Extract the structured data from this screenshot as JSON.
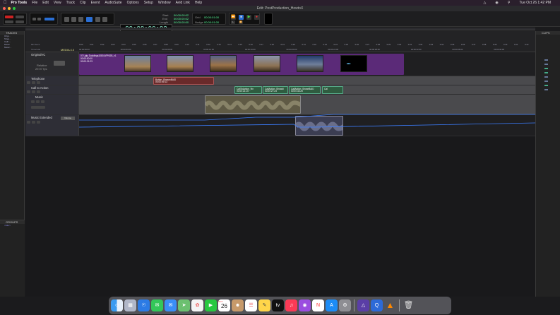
{
  "menubar": {
    "app_name": "Pro Tools",
    "items": [
      "File",
      "Edit",
      "View",
      "Track",
      "Clip",
      "Event",
      "AudioSuite",
      "Options",
      "Setup",
      "Window",
      "Avid Link",
      "Help"
    ],
    "clock": "Tue Oct 26  1:42 PM"
  },
  "window": {
    "title": "Edit: PostProduction_HowtoX"
  },
  "toolbar": {
    "main_counter": "00:00:00:02",
    "sub_labels": {
      "start": "Start",
      "end": "End",
      "length": "Length"
    },
    "start_value": "00:00:00:02",
    "end_value": "00:00:00:02",
    "length_value": "00:00:00:00",
    "cursor_label": "Cursor",
    "cursor_value": "00:00:12:24:00",
    "nudge_label": "Nudge",
    "grid_label": "Grid",
    "grid_value": "00:00:01:00",
    "nudge_value": "00:00:01:00"
  },
  "panels": {
    "tracks_title": "TRACKS",
    "clips_title": "CLIPS",
    "groups_title": "GROUPS",
    "groups_item": "<ALL>"
  },
  "track_list": [
    "Origi...",
    "Telep...",
    "Call t...",
    "Music",
    "Music..."
  ],
  "rulers": {
    "rows": [
      "Min:Secs",
      "Timecode"
    ],
    "ticks_minsecs": [
      "0:00",
      "0:01",
      "0:02",
      "0:03",
      "0:04",
      "0:05",
      "0:06",
      "0:07",
      "0:08",
      "0:09",
      "0:10",
      "0:11",
      "0:12",
      "0:13",
      "0:14",
      "0:15",
      "0:16",
      "0:17",
      "0:18",
      "0:19",
      "0:20",
      "0:21",
      "0:22",
      "0:23",
      "0:24",
      "0:25",
      "0:26",
      "0:27",
      "0:28",
      "0:29",
      "0:30",
      "0:31",
      "0:32",
      "0:33",
      "0:34",
      "0:35",
      "0:36",
      "0:37",
      "0:38",
      "0:39",
      "0:40",
      "0:41",
      "0:42"
    ],
    "ticks_timecode": [
      "00:00:00:00",
      "00:00:04:00",
      "00:00:08:00",
      "00:00:12:00",
      "00:00:16:00",
      "00:00:20:00",
      "00:00:24:00",
      "00:00:28:00",
      "00:00:32:00",
      "00:00:36:00",
      "00:00:40:00"
    ]
  },
  "tracks": [
    {
      "name": "OriginalVC",
      "sub": "Relative",
      "rate": "29.97 fps",
      "kind": "video"
    },
    {
      "name": "Telephone",
      "kind": "audio"
    },
    {
      "name": "Call to Action",
      "kind": "audio"
    },
    {
      "name": "Music",
      "kind": "audio"
    },
    {
      "name": "Music Extended",
      "kind": "audio",
      "button": "Volume"
    }
  ],
  "clips": {
    "video": {
      "label": "07 Ugly Ducklings1080-6/PNGB_v1",
      "tc1": "00:00:00:00",
      "tc2": "00:00:21:23",
      "badge": "MEDIA 4.0"
    },
    "telephone": {
      "label": "Button_ShowroBAID",
      "tc": "00:00:09:13"
    },
    "cta": [
      {
        "label": "CallToAction_Vin",
        "tc": "00:00:21:15"
      },
      {
        "label": "CallAction_Showdi",
        "tc": "00:00:27:23"
      },
      {
        "label": "CallAction_ShowrBAID",
        "tc": "00:00:33:20"
      },
      {
        "label": "Cal"
      }
    ]
  },
  "dock_icons": [
    "finder-icon",
    "launchpad-icon",
    "safari-icon",
    "messages-icon",
    "mail-icon",
    "maps-icon",
    "photos-icon",
    "facetime-icon",
    "calendar-icon",
    "contacts-icon",
    "reminders-icon",
    "notes-icon",
    "apple-tv-icon",
    "music-icon",
    "podcasts-icon",
    "news-icon",
    "app-store-icon",
    "system-preferences-icon",
    "avid-link-icon",
    "quicktime-icon",
    "vlc-icon",
    "trash-icon"
  ],
  "calendar_day": "26",
  "calendar_month": "OCT",
  "colors": {
    "accent": "#3c7eff",
    "clip_green": "#2f5c40",
    "clip_red": "#6a2a2a",
    "video_purple": "#5b2a78"
  }
}
